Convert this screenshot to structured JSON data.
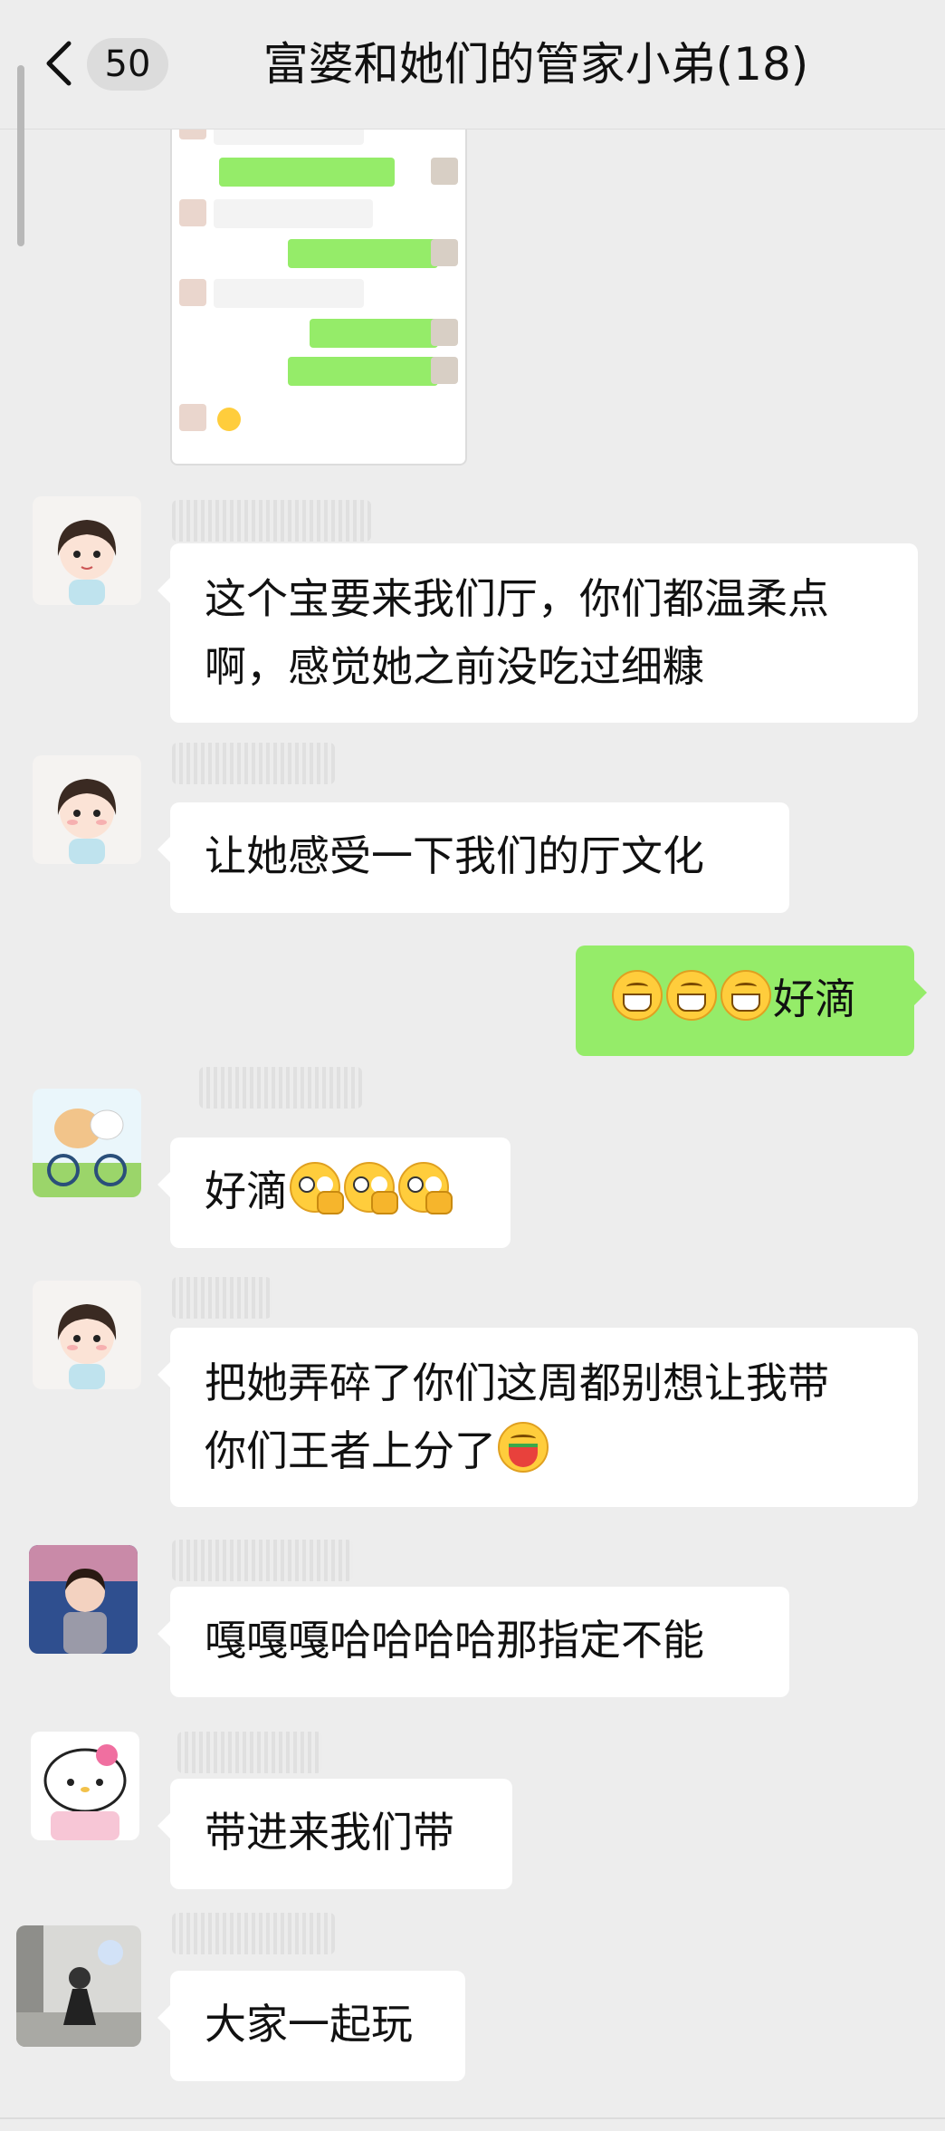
{
  "header": {
    "unread_count": "50",
    "title": "富婆和她们的管家小弟(18)"
  },
  "messages": [
    {
      "id": "m1",
      "side": "left",
      "text": "这个宝要来我们厅，你们都温柔点啊，感觉她之前没吃过细糠",
      "line1": "这个宝要来我们厅，你们都温柔点",
      "line2": "啊，感觉她之前没吃过细糠"
    },
    {
      "id": "m2",
      "side": "left",
      "text": "让她感受一下我们的厅文化"
    },
    {
      "id": "m3",
      "side": "right",
      "text": "好滴",
      "emoji": "grinning-face-emoji",
      "emoji_count": 3
    },
    {
      "id": "m4",
      "side": "left",
      "text": "好滴",
      "emoji": "peeking-face-emoji",
      "emoji_count": 3
    },
    {
      "id": "m5",
      "side": "left",
      "line1": "把她弄碎了你们这周都别想让我带",
      "line2": "你们王者上分了",
      "emoji": "watermelon-emoji",
      "emoji_count": 1
    },
    {
      "id": "m6",
      "side": "left",
      "text": "嘎嘎嘎哈哈哈哈那指定不能"
    },
    {
      "id": "m7",
      "side": "left",
      "text": "带进来我们带"
    },
    {
      "id": "m8",
      "side": "left",
      "text": "大家一起玩"
    }
  ],
  "colors": {
    "background": "#ededed",
    "my_bubble": "#95ec69",
    "other_bubble": "#ffffff"
  }
}
